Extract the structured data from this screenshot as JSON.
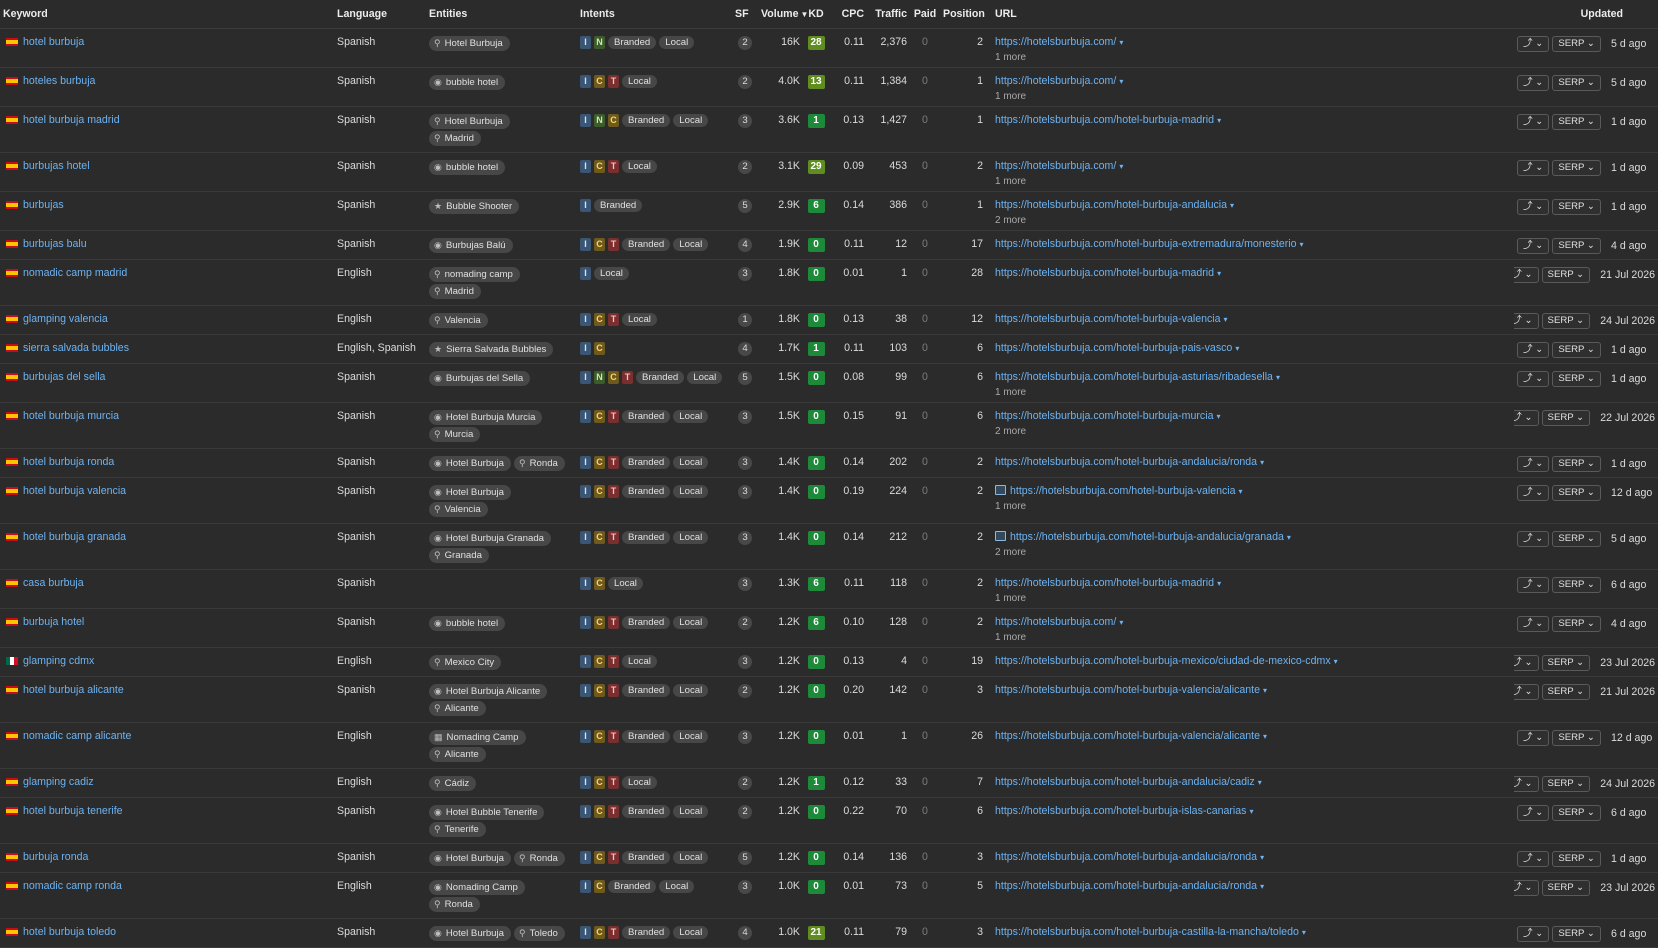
{
  "headers": {
    "keyword": "Keyword",
    "language": "Language",
    "entities": "Entities",
    "intents": "Intents",
    "sf": "SF",
    "volume": "Volume",
    "kd": "KD",
    "cpc": "CPC",
    "traffic": "Traffic",
    "paid": "Paid",
    "position": "Position",
    "url": "URL",
    "updated": "Updated"
  },
  "serp_label": "SERP",
  "colors": {
    "link": "#6db3f2",
    "kd_green": "#1d8a3a",
    "kd_olive": "#5f8d1f"
  },
  "rows": [
    {
      "flag": "es",
      "keyword": "hotel burbuja",
      "language": "Spanish",
      "entities": [
        [
          {
            "icon": "pin",
            "label": "Hotel Burbuja"
          }
        ]
      ],
      "intents": [
        "I",
        "N"
      ],
      "tags": [
        "Branded",
        "Local"
      ],
      "sf": "2",
      "volume": "16K",
      "kd": "28",
      "cpc": "0.11",
      "traffic": "2,376",
      "paid": "0",
      "position": "2",
      "url": "https://hotelsburbuja.com/",
      "url_img": false,
      "more": "1 more",
      "updated": "5 d ago"
    },
    {
      "flag": "es",
      "keyword": "hoteles burbuja",
      "language": "Spanish",
      "entities": [
        [
          {
            "icon": "ent",
            "label": "bubble hotel"
          }
        ]
      ],
      "intents": [
        "I",
        "C",
        "T"
      ],
      "tags": [
        "Local"
      ],
      "sf": "2",
      "volume": "4.0K",
      "kd": "13",
      "cpc": "0.11",
      "traffic": "1,384",
      "paid": "0",
      "position": "1",
      "url": "https://hotelsburbuja.com/",
      "url_img": false,
      "more": "1 more",
      "updated": "5 d ago"
    },
    {
      "flag": "es",
      "keyword": "hotel burbuja madrid",
      "language": "Spanish",
      "entities": [
        [
          {
            "icon": "pin",
            "label": "Hotel Burbuja"
          }
        ],
        [
          {
            "icon": "pin",
            "label": "Madrid"
          }
        ]
      ],
      "intents": [
        "I",
        "N",
        "C"
      ],
      "tags": [
        "Branded",
        "Local"
      ],
      "sf": "3",
      "volume": "3.6K",
      "kd": "1",
      "cpc": "0.13",
      "traffic": "1,427",
      "paid": "0",
      "position": "1",
      "url": "https://hotelsburbuja.com/hotel-burbuja-madrid",
      "url_img": false,
      "more": "",
      "updated": "1 d ago"
    },
    {
      "flag": "es",
      "keyword": "burbujas hotel",
      "language": "Spanish",
      "entities": [
        [
          {
            "icon": "ent",
            "label": "bubble hotel"
          }
        ]
      ],
      "intents": [
        "I",
        "C",
        "T"
      ],
      "tags": [
        "Local"
      ],
      "sf": "2",
      "volume": "3.1K",
      "kd": "29",
      "cpc": "0.09",
      "traffic": "453",
      "paid": "0",
      "position": "2",
      "url": "https://hotelsburbuja.com/",
      "url_img": false,
      "more": "1 more",
      "updated": "1 d ago"
    },
    {
      "flag": "es",
      "keyword": "burbujas",
      "language": "Spanish",
      "entities": [
        [
          {
            "icon": "star",
            "label": "Bubble Shooter"
          }
        ]
      ],
      "intents": [
        "I"
      ],
      "tags": [
        "Branded"
      ],
      "sf": "5",
      "volume": "2.9K",
      "kd": "6",
      "cpc": "0.14",
      "traffic": "386",
      "paid": "0",
      "position": "1",
      "url": "https://hotelsburbuja.com/hotel-burbuja-andalucia",
      "url_img": false,
      "more": "2 more",
      "updated": "1 d ago"
    },
    {
      "flag": "es",
      "keyword": "burbujas balu",
      "language": "Spanish",
      "entities": [
        [
          {
            "icon": "ent",
            "label": "Burbujas Balú"
          }
        ]
      ],
      "intents": [
        "I",
        "C",
        "T"
      ],
      "tags": [
        "Branded",
        "Local"
      ],
      "sf": "4",
      "volume": "1.9K",
      "kd": "0",
      "cpc": "0.11",
      "traffic": "12",
      "paid": "0",
      "position": "17",
      "url": "https://hotelsburbuja.com/hotel-burbuja-extremadura/monesterio",
      "url_img": false,
      "more": "",
      "updated": "4 d ago"
    },
    {
      "flag": "es",
      "keyword": "nomadic camp madrid",
      "language": "English",
      "entities": [
        [
          {
            "icon": "pin",
            "label": "nomading camp"
          }
        ],
        [
          {
            "icon": "pin",
            "label": "Madrid"
          }
        ]
      ],
      "intents": [
        "I"
      ],
      "tags": [
        "Local"
      ],
      "sf": "3",
      "volume": "1.8K",
      "kd": "0",
      "cpc": "0.01",
      "traffic": "1",
      "paid": "0",
      "position": "28",
      "url": "https://hotelsburbuja.com/hotel-burbuja-madrid",
      "url_img": false,
      "more": "",
      "updated": "21 Jul 2026"
    },
    {
      "flag": "es",
      "keyword": "glamping valencia",
      "language": "English",
      "entities": [
        [
          {
            "icon": "pin",
            "label": "Valencia"
          }
        ]
      ],
      "intents": [
        "I",
        "C",
        "T"
      ],
      "tags": [
        "Local"
      ],
      "sf": "1",
      "volume": "1.8K",
      "kd": "0",
      "cpc": "0.13",
      "traffic": "38",
      "paid": "0",
      "position": "12",
      "url": "https://hotelsburbuja.com/hotel-burbuja-valencia",
      "url_img": false,
      "more": "",
      "updated": "24 Jul 2026"
    },
    {
      "flag": "es",
      "keyword": "sierra salvada bubbles",
      "language": "English, Spanish",
      "entities": [
        [
          {
            "icon": "star",
            "label": "Sierra Salvada Bubbles"
          }
        ]
      ],
      "intents": [
        "I",
        "C"
      ],
      "tags": [],
      "sf": "4",
      "volume": "1.7K",
      "kd": "1",
      "cpc": "0.11",
      "traffic": "103",
      "paid": "0",
      "position": "6",
      "url": "https://hotelsburbuja.com/hotel-burbuja-pais-vasco",
      "url_img": false,
      "more": "",
      "updated": "1 d ago"
    },
    {
      "flag": "es",
      "keyword": "burbujas del sella",
      "language": "Spanish",
      "entities": [
        [
          {
            "icon": "ent",
            "label": "Burbujas del Sella"
          }
        ]
      ],
      "intents": [
        "I",
        "N",
        "C",
        "T"
      ],
      "tags": [
        "Branded",
        "Local"
      ],
      "sf": "5",
      "volume": "1.5K",
      "kd": "0",
      "cpc": "0.08",
      "traffic": "99",
      "paid": "0",
      "position": "6",
      "url": "https://hotelsburbuja.com/hotel-burbuja-asturias/ribadesella",
      "url_img": false,
      "more": "1 more",
      "updated": "1 d ago"
    },
    {
      "flag": "es",
      "keyword": "hotel burbuja murcia",
      "language": "Spanish",
      "entities": [
        [
          {
            "icon": "ent",
            "label": "Hotel Burbuja Murcia"
          }
        ],
        [
          {
            "icon": "pin",
            "label": "Murcia"
          }
        ]
      ],
      "intents": [
        "I",
        "C",
        "T"
      ],
      "tags": [
        "Branded",
        "Local"
      ],
      "sf": "3",
      "volume": "1.5K",
      "kd": "0",
      "cpc": "0.15",
      "traffic": "91",
      "paid": "0",
      "position": "6",
      "url": "https://hotelsburbuja.com/hotel-burbuja-murcia",
      "url_img": false,
      "more": "2 more",
      "updated": "22 Jul 2026"
    },
    {
      "flag": "es",
      "keyword": "hotel burbuja ronda",
      "language": "Spanish",
      "entities": [
        [
          {
            "icon": "ent",
            "label": "Hotel Burbuja"
          },
          {
            "icon": "pin",
            "label": "Ronda"
          }
        ]
      ],
      "intents": [
        "I",
        "C",
        "T"
      ],
      "tags": [
        "Branded",
        "Local"
      ],
      "sf": "3",
      "volume": "1.4K",
      "kd": "0",
      "cpc": "0.14",
      "traffic": "202",
      "paid": "0",
      "position": "2",
      "url": "https://hotelsburbuja.com/hotel-burbuja-andalucia/ronda",
      "url_img": false,
      "more": "",
      "updated": "1 d ago"
    },
    {
      "flag": "es",
      "keyword": "hotel burbuja valencia",
      "language": "Spanish",
      "entities": [
        [
          {
            "icon": "ent",
            "label": "Hotel Burbuja"
          }
        ],
        [
          {
            "icon": "pin",
            "label": "Valencia"
          }
        ]
      ],
      "intents": [
        "I",
        "C",
        "T"
      ],
      "tags": [
        "Branded",
        "Local"
      ],
      "sf": "3",
      "volume": "1.4K",
      "kd": "0",
      "cpc": "0.19",
      "traffic": "224",
      "paid": "0",
      "position": "2",
      "url": "https://hotelsburbuja.com/hotel-burbuja-valencia",
      "url_img": true,
      "more": "1 more",
      "updated": "12 d ago"
    },
    {
      "flag": "es",
      "keyword": "hotel burbuja granada",
      "language": "Spanish",
      "entities": [
        [
          {
            "icon": "ent",
            "label": "Hotel Burbuja Granada"
          }
        ],
        [
          {
            "icon": "pin",
            "label": "Granada"
          }
        ]
      ],
      "intents": [
        "I",
        "C",
        "T"
      ],
      "tags": [
        "Branded",
        "Local"
      ],
      "sf": "3",
      "volume": "1.4K",
      "kd": "0",
      "cpc": "0.14",
      "traffic": "212",
      "paid": "0",
      "position": "2",
      "url": "https://hotelsburbuja.com/hotel-burbuja-andalucia/granada",
      "url_img": true,
      "more": "2 more",
      "updated": "5 d ago"
    },
    {
      "flag": "es",
      "keyword": "casa burbuja",
      "language": "Spanish",
      "entities": [],
      "intents": [
        "I",
        "C"
      ],
      "tags": [
        "Local"
      ],
      "sf": "3",
      "volume": "1.3K",
      "kd": "6",
      "cpc": "0.11",
      "traffic": "118",
      "paid": "0",
      "position": "2",
      "url": "https://hotelsburbuja.com/hotel-burbuja-madrid",
      "url_img": false,
      "more": "1 more",
      "updated": "6 d ago"
    },
    {
      "flag": "es",
      "keyword": "burbuja hotel",
      "language": "Spanish",
      "entities": [
        [
          {
            "icon": "ent",
            "label": "bubble hotel"
          }
        ]
      ],
      "intents": [
        "I",
        "C",
        "T"
      ],
      "tags": [
        "Branded",
        "Local"
      ],
      "sf": "2",
      "volume": "1.2K",
      "kd": "6",
      "cpc": "0.10",
      "traffic": "128",
      "paid": "0",
      "position": "2",
      "url": "https://hotelsburbuja.com/",
      "url_img": false,
      "more": "1 more",
      "updated": "4 d ago"
    },
    {
      "flag": "mx",
      "keyword": "glamping cdmx",
      "language": "English",
      "entities": [
        [
          {
            "icon": "pin",
            "label": "Mexico City"
          }
        ]
      ],
      "intents": [
        "I",
        "C",
        "T"
      ],
      "tags": [
        "Local"
      ],
      "sf": "3",
      "volume": "1.2K",
      "kd": "0",
      "cpc": "0.13",
      "traffic": "4",
      "paid": "0",
      "position": "19",
      "url": "https://hotelsburbuja.com/hotel-burbuja-mexico/ciudad-de-mexico-cdmx",
      "url_img": false,
      "more": "",
      "updated": "23 Jul 2026"
    },
    {
      "flag": "es",
      "keyword": "hotel burbuja alicante",
      "language": "Spanish",
      "entities": [
        [
          {
            "icon": "ent",
            "label": "Hotel Burbuja Alicante"
          }
        ],
        [
          {
            "icon": "pin",
            "label": "Alicante"
          }
        ]
      ],
      "intents": [
        "I",
        "C",
        "T"
      ],
      "tags": [
        "Branded",
        "Local"
      ],
      "sf": "2",
      "volume": "1.2K",
      "kd": "0",
      "cpc": "0.20",
      "traffic": "142",
      "paid": "0",
      "position": "3",
      "url": "https://hotelsburbuja.com/hotel-burbuja-valencia/alicante",
      "url_img": false,
      "more": "",
      "updated": "21 Jul 2026"
    },
    {
      "flag": "es",
      "keyword": "nomadic camp alicante",
      "language": "English",
      "entities": [
        [
          {
            "icon": "bld",
            "label": "Nomading Camp"
          }
        ],
        [
          {
            "icon": "pin",
            "label": "Alicante"
          }
        ]
      ],
      "intents": [
        "I",
        "C",
        "T"
      ],
      "tags": [
        "Branded",
        "Local"
      ],
      "sf": "3",
      "volume": "1.2K",
      "kd": "0",
      "cpc": "0.01",
      "traffic": "1",
      "paid": "0",
      "position": "26",
      "url": "https://hotelsburbuja.com/hotel-burbuja-valencia/alicante",
      "url_img": false,
      "more": "",
      "updated": "12 d ago"
    },
    {
      "flag": "es",
      "keyword": "glamping cadiz",
      "language": "English",
      "entities": [
        [
          {
            "icon": "pin",
            "label": "Cádiz"
          }
        ]
      ],
      "intents": [
        "I",
        "C",
        "T"
      ],
      "tags": [
        "Local"
      ],
      "sf": "2",
      "volume": "1.2K",
      "kd": "1",
      "cpc": "0.12",
      "traffic": "33",
      "paid": "0",
      "position": "7",
      "url": "https://hotelsburbuja.com/hotel-burbuja-andalucia/cadiz",
      "url_img": false,
      "more": "",
      "updated": "24 Jul 2026"
    },
    {
      "flag": "es",
      "keyword": "hotel burbuja tenerife",
      "language": "Spanish",
      "entities": [
        [
          {
            "icon": "ent",
            "label": "Hotel Bubble Tenerife"
          }
        ],
        [
          {
            "icon": "pin",
            "label": "Tenerife"
          }
        ]
      ],
      "intents": [
        "I",
        "C",
        "T"
      ],
      "tags": [
        "Branded",
        "Local"
      ],
      "sf": "2",
      "volume": "1.2K",
      "kd": "0",
      "cpc": "0.22",
      "traffic": "70",
      "paid": "0",
      "position": "6",
      "url": "https://hotelsburbuja.com/hotel-burbuja-islas-canarias",
      "url_img": false,
      "more": "",
      "updated": "6 d ago"
    },
    {
      "flag": "es",
      "keyword": "burbuja ronda",
      "language": "Spanish",
      "entities": [
        [
          {
            "icon": "ent",
            "label": "Hotel Burbuja"
          },
          {
            "icon": "pin",
            "label": "Ronda"
          }
        ]
      ],
      "intents": [
        "I",
        "C",
        "T"
      ],
      "tags": [
        "Branded",
        "Local"
      ],
      "sf": "5",
      "volume": "1.2K",
      "kd": "0",
      "cpc": "0.14",
      "traffic": "136",
      "paid": "0",
      "position": "3",
      "url": "https://hotelsburbuja.com/hotel-burbuja-andalucia/ronda",
      "url_img": false,
      "more": "",
      "updated": "1 d ago"
    },
    {
      "flag": "es",
      "keyword": "nomadic camp ronda",
      "language": "English",
      "entities": [
        [
          {
            "icon": "ent",
            "label": "Nomading Camp"
          }
        ],
        [
          {
            "icon": "pin",
            "label": "Ronda"
          }
        ]
      ],
      "intents": [
        "I",
        "C"
      ],
      "tags": [
        "Branded",
        "Local"
      ],
      "sf": "3",
      "volume": "1.0K",
      "kd": "0",
      "cpc": "0.01",
      "traffic": "73",
      "paid": "0",
      "position": "5",
      "url": "https://hotelsburbuja.com/hotel-burbuja-andalucia/ronda",
      "url_img": false,
      "more": "",
      "updated": "23 Jul 2026"
    },
    {
      "flag": "es",
      "keyword": "hotel burbuja toledo",
      "language": "Spanish",
      "entities": [
        [
          {
            "icon": "ent",
            "label": "Hotel Burbuja"
          },
          {
            "icon": "pin",
            "label": "Toledo"
          }
        ]
      ],
      "intents": [
        "I",
        "C",
        "T"
      ],
      "tags": [
        "Branded",
        "Local"
      ],
      "sf": "4",
      "volume": "1.0K",
      "kd": "21",
      "cpc": "0.11",
      "traffic": "79",
      "paid": "0",
      "position": "3",
      "url": "https://hotelsburbuja.com/hotel-burbuja-castilla-la-mancha/toledo",
      "url_img": false,
      "more": "",
      "updated": "6 d ago"
    }
  ]
}
